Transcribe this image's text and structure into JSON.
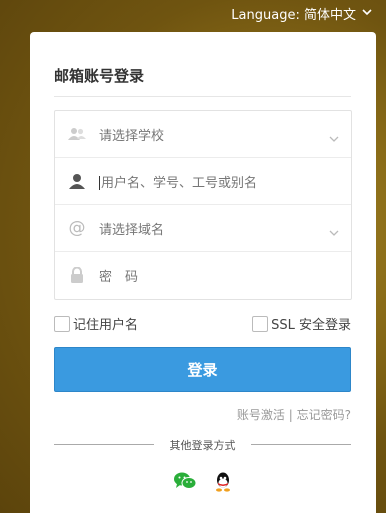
{
  "language": {
    "label": "Language:",
    "value": "简体中文"
  },
  "login": {
    "title": "邮箱账号登录",
    "school_placeholder": "请选择学校",
    "username_placeholder": "用户名、学号、工号或别名",
    "domain_placeholder": "请选择域名",
    "password_placeholder": "密　码",
    "remember_label": "记住用户名",
    "ssl_label": "SSL 安全登录",
    "submit_label": "登录",
    "activate_link": "账号激活",
    "link_separator": "|",
    "forgot_link": "忘记密码?",
    "other_methods": "其他登录方式"
  },
  "icons": {
    "language_caret": "chevron-down-icon",
    "school": "users-icon",
    "user": "user-icon",
    "domain": "at-icon",
    "password": "lock-icon",
    "dropdown": "chevron-down-icon",
    "wechat": "wechat-icon",
    "qq": "qq-icon"
  },
  "colors": {
    "primary": "#3a9ae0",
    "wechat": "#2aae3a"
  }
}
